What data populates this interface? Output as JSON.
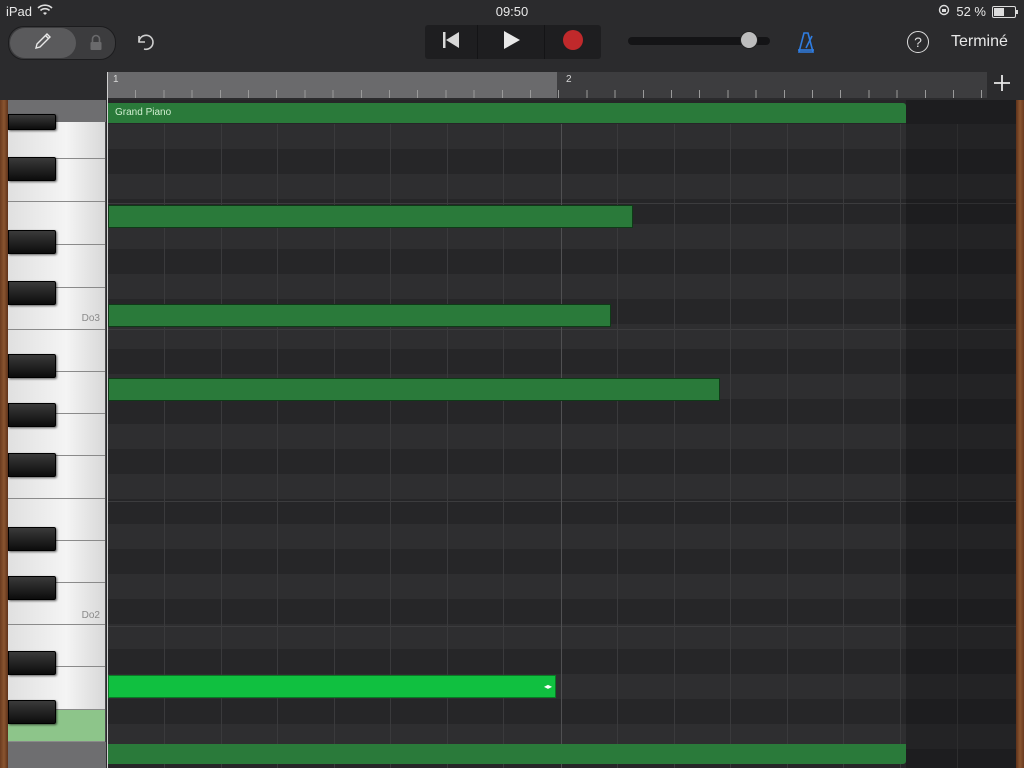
{
  "status_bar": {
    "device": "iPad",
    "time": "09:50",
    "battery": "52 %",
    "battery_level": 0.52
  },
  "toolbar": {
    "done_label": "Terminé",
    "help_label": "?",
    "volume_level": 0.9,
    "accent_color": "#2f7de1",
    "record_color": "#c0292b"
  },
  "ruler": {
    "bar_1": "1",
    "bar_2": "2"
  },
  "keyboard": {
    "labels": {
      "c3": "Do3",
      "c2": "Do2"
    }
  },
  "region": {
    "name": "Grand Piano",
    "color": "#2a7a3a"
  },
  "notes": [
    {
      "pitch": "G#3",
      "length_bars": 1.16,
      "selected": false
    },
    {
      "pitch": "C3",
      "length_bars": 1.11,
      "selected": false
    },
    {
      "pitch": "A2",
      "length_bars": 1.35,
      "selected": false
    },
    {
      "pitch": "C#2",
      "length_bars": 0.99,
      "selected": true
    }
  ]
}
